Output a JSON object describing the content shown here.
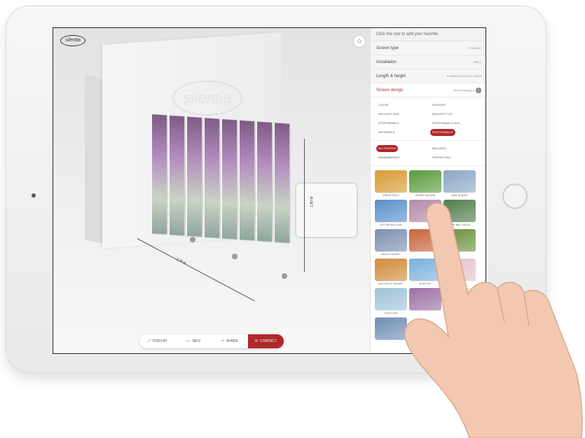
{
  "toolbar": {
    "display": "DISPLAY",
    "info": "INFO",
    "share": "SHARE",
    "contact": "CONTACT"
  },
  "viewport": {
    "logo_text": "silentia",
    "dim_width": "3.20 m",
    "dim_height": "1.80 M"
  },
  "sidebar": {
    "hint": "Click the star to add your favorite.",
    "rows": [
      {
        "label": "Screen type",
        "value": "FOLDING"
      },
      {
        "label": "Installation",
        "value": "WALL"
      },
      {
        "label": "Length & height",
        "value": "6 PANELS 3.20 M X 1.80 M"
      },
      {
        "label": "Screen design",
        "value": "PHOTOPANELS"
      }
    ],
    "design_options": [
      "COLOR",
      "DAYLIGHT",
      "DAYLIGHT DUO",
      "DAYLIGHT TOP",
      "STORYPANELS",
      "STORYPANELS DUO",
      "ARTPANELS",
      "PHOTOPANELS"
    ],
    "selected_design": "PHOTOPANELS",
    "photo_filters": [
      "ALL PHOTOS",
      "RELAXING",
      "REMEMBERING",
      "PROTECTING"
    ],
    "selected_filter": "ALL PHOTOS",
    "photos": [
      {
        "label": "WHEAT FIELD",
        "color": "#d79a32"
      },
      {
        "label": "SPRING NATURE",
        "color": "#5a9a3c"
      },
      {
        "label": "LAKE SUNSET",
        "color": "#8aa7c4"
      },
      {
        "label": "HOT AIR BALLOON",
        "color": "#5a8fc9"
      },
      {
        "label": "",
        "color": "#b38aa8"
      },
      {
        "label": "BLUE BELL WOOD",
        "color": "#4f7d4a"
      },
      {
        "label": "BEACH SUNSET",
        "color": "#7c8fb0"
      },
      {
        "label": "",
        "color": "#c8643a"
      },
      {
        "label": "",
        "color": "#6b8f3a"
      },
      {
        "label": "BICYCLE AT SUNSET",
        "color": "#d08b3b"
      },
      {
        "label": "BLUE SKY",
        "color": "#7ab0da"
      },
      {
        "label": "",
        "color": "#e3c3cd"
      },
      {
        "label": "CALM LAKE",
        "color": "#9fc3d8"
      },
      {
        "label": "",
        "color": "#9d6fa3"
      },
      {
        "label": "",
        "color": "#e6e6e6"
      },
      {
        "label": "",
        "color": "#6f8db5"
      }
    ]
  }
}
